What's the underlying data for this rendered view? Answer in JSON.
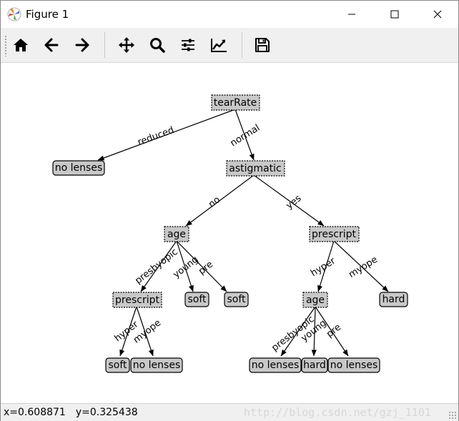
{
  "window": {
    "title": "Figure 1"
  },
  "toolbar": {
    "buttons": [
      {
        "icon": "home-icon"
      },
      {
        "icon": "back-arrow-icon"
      },
      {
        "icon": "forward-arrow-icon"
      },
      {
        "icon": "pan-icon"
      },
      {
        "icon": "zoom-icon"
      },
      {
        "icon": "subplots-icon"
      },
      {
        "icon": "edit-axis-icon"
      },
      {
        "icon": "save-icon"
      }
    ]
  },
  "tree": {
    "decision_nodes": [
      "tearRate",
      "astigmatic",
      "age",
      "prescript",
      "prescript",
      "age"
    ],
    "leaf_nodes": [
      "no lenses",
      "soft",
      "soft",
      "hard",
      "soft",
      "no lenses",
      "no lenses",
      "hard",
      "no lenses"
    ],
    "edge_labels": [
      "reduced",
      "normal",
      "no",
      "yes",
      "presbyopic",
      "young",
      "pre",
      "hyper",
      "myope",
      "hyper",
      "myope",
      "presbyopic",
      "young",
      "pre"
    ]
  },
  "status": {
    "x": "x=0.608871",
    "y": "y=0.325438",
    "watermark": "http://blog.csdn.net/gzj_1101"
  },
  "colors": {
    "node_fill": "#c8c8c8",
    "toolbar_bg": "#f0f0f0"
  }
}
